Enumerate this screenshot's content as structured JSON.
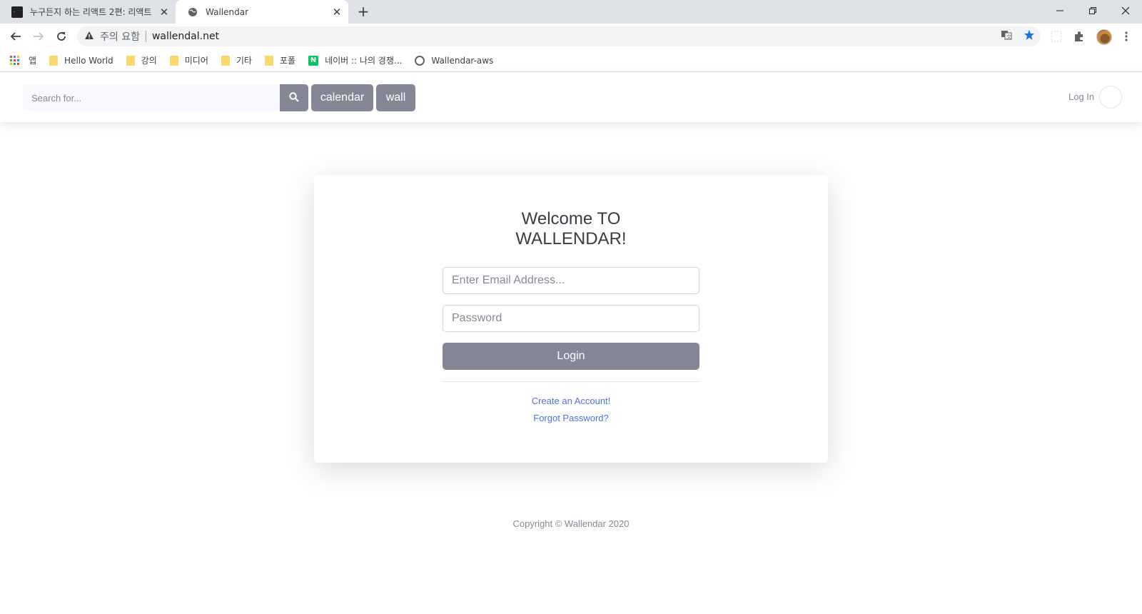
{
  "browser": {
    "tabs": [
      {
        "title": "누구든지 하는 리액트 2편: 리액트",
        "favicon": "velog-favicon"
      },
      {
        "title": "Wallendar",
        "favicon": "globe-icon"
      }
    ],
    "address": {
      "security_label": "주의 요함",
      "url": "wallendal.net"
    },
    "bookmarks": [
      {
        "label": "앱",
        "icon": "apps-grid-icon"
      },
      {
        "label": "Hello World",
        "icon": "folder-icon"
      },
      {
        "label": "강의",
        "icon": "folder-icon"
      },
      {
        "label": "미디어",
        "icon": "folder-icon"
      },
      {
        "label": "기타",
        "icon": "folder-icon"
      },
      {
        "label": "포폴",
        "icon": "folder-icon"
      },
      {
        "label": "네이버 :: 나의 경쟁...",
        "icon": "naver-icon"
      },
      {
        "label": "Wallendar-aws",
        "icon": "globe-icon"
      }
    ],
    "colors": {
      "tabstrip": "#dee1e6",
      "star": "#1a73e8"
    }
  },
  "header": {
    "search": {
      "placeholder": "Search for..."
    },
    "buttons": {
      "calendar": "calendar",
      "wall": "wall"
    },
    "login_link": "Log In"
  },
  "login_card": {
    "title_line1": "Welcome TO",
    "title_line2": "WALLENDAR!",
    "email_placeholder": "Enter Email Address...",
    "password_placeholder": "Password",
    "login_button": "Login",
    "create_account": "Create an Account!",
    "forgot_password": "Forgot Password?"
  },
  "footer": {
    "copyright": "Copyright © Wallendar 2020"
  },
  "theme": {
    "secondary": "#858796",
    "link": "#4e73df",
    "text": "#3a3b45"
  }
}
